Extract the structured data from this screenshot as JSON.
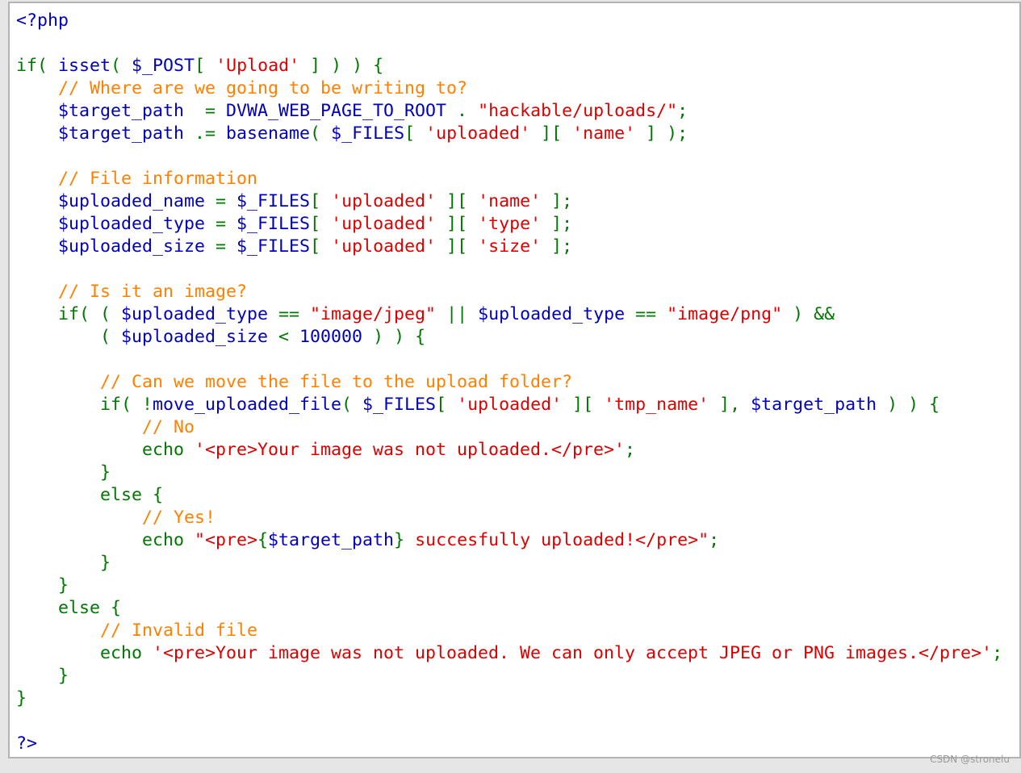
{
  "colors": {
    "html": "#0000bb",
    "default": "#0000bb",
    "keyword": "#007700",
    "string": "#dd0000",
    "comment": "#ff8000",
    "background": "#ffffff",
    "border": "#b4b4b4"
  },
  "code": {
    "language": "php",
    "lines": [
      [
        [
          "html",
          "<?php"
        ]
      ],
      [],
      [
        [
          "keyword",
          "if( "
        ],
        [
          "default",
          "isset"
        ],
        [
          "keyword",
          "( "
        ],
        [
          "default",
          "$_POST"
        ],
        [
          "keyword",
          "[ "
        ],
        [
          "string",
          "'Upload'"
        ],
        [
          "keyword",
          " ] ) ) {"
        ]
      ],
      [
        [
          "comment",
          "    // Where are we going to be writing to?"
        ]
      ],
      [
        [
          "default",
          "    $target_path  "
        ],
        [
          "keyword",
          "= "
        ],
        [
          "default",
          "DVWA_WEB_PAGE_TO_ROOT "
        ],
        [
          "keyword",
          ". "
        ],
        [
          "string",
          "\"hackable/uploads/\""
        ],
        [
          "keyword",
          ";"
        ]
      ],
      [
        [
          "default",
          "    $target_path "
        ],
        [
          "keyword",
          ".= "
        ],
        [
          "default",
          "basename"
        ],
        [
          "keyword",
          "( "
        ],
        [
          "default",
          "$_FILES"
        ],
        [
          "keyword",
          "[ "
        ],
        [
          "string",
          "'uploaded'"
        ],
        [
          "keyword",
          " ][ "
        ],
        [
          "string",
          "'name'"
        ],
        [
          "keyword",
          " ] );"
        ]
      ],
      [],
      [
        [
          "comment",
          "    // File information"
        ]
      ],
      [
        [
          "default",
          "    $uploaded_name "
        ],
        [
          "keyword",
          "= "
        ],
        [
          "default",
          "$_FILES"
        ],
        [
          "keyword",
          "[ "
        ],
        [
          "string",
          "'uploaded'"
        ],
        [
          "keyword",
          " ][ "
        ],
        [
          "string",
          "'name'"
        ],
        [
          "keyword",
          " ];"
        ]
      ],
      [
        [
          "default",
          "    $uploaded_type "
        ],
        [
          "keyword",
          "= "
        ],
        [
          "default",
          "$_FILES"
        ],
        [
          "keyword",
          "[ "
        ],
        [
          "string",
          "'uploaded'"
        ],
        [
          "keyword",
          " ][ "
        ],
        [
          "string",
          "'type'"
        ],
        [
          "keyword",
          " ];"
        ]
      ],
      [
        [
          "default",
          "    $uploaded_size "
        ],
        [
          "keyword",
          "= "
        ],
        [
          "default",
          "$_FILES"
        ],
        [
          "keyword",
          "[ "
        ],
        [
          "string",
          "'uploaded'"
        ],
        [
          "keyword",
          " ][ "
        ],
        [
          "string",
          "'size'"
        ],
        [
          "keyword",
          " ];"
        ]
      ],
      [],
      [
        [
          "comment",
          "    // Is it an image?"
        ]
      ],
      [
        [
          "keyword",
          "    if( ( "
        ],
        [
          "default",
          "$uploaded_type "
        ],
        [
          "keyword",
          "== "
        ],
        [
          "string",
          "\"image/jpeg\""
        ],
        [
          "keyword",
          " || "
        ],
        [
          "default",
          "$uploaded_type "
        ],
        [
          "keyword",
          "== "
        ],
        [
          "string",
          "\"image/png\""
        ],
        [
          "keyword",
          " ) &&"
        ]
      ],
      [
        [
          "keyword",
          "        ( "
        ],
        [
          "default",
          "$uploaded_size "
        ],
        [
          "keyword",
          "< "
        ],
        [
          "default",
          "100000"
        ],
        [
          "keyword",
          " ) ) {"
        ]
      ],
      [],
      [
        [
          "comment",
          "        // Can we move the file to the upload folder?"
        ]
      ],
      [
        [
          "keyword",
          "        if( !"
        ],
        [
          "default",
          "move_uploaded_file"
        ],
        [
          "keyword",
          "( "
        ],
        [
          "default",
          "$_FILES"
        ],
        [
          "keyword",
          "[ "
        ],
        [
          "string",
          "'uploaded'"
        ],
        [
          "keyword",
          " ][ "
        ],
        [
          "string",
          "'tmp_name'"
        ],
        [
          "keyword",
          " ], "
        ],
        [
          "default",
          "$target_path"
        ],
        [
          "keyword",
          " ) ) {"
        ]
      ],
      [
        [
          "comment",
          "            // No"
        ]
      ],
      [
        [
          "keyword",
          "            echo "
        ],
        [
          "string",
          "'<pre>Your image was not uploaded.</pre>'"
        ],
        [
          "keyword",
          ";"
        ]
      ],
      [
        [
          "keyword",
          "        }"
        ]
      ],
      [
        [
          "keyword",
          "        else {"
        ]
      ],
      [
        [
          "comment",
          "            // Yes!"
        ]
      ],
      [
        [
          "keyword",
          "            echo "
        ],
        [
          "string",
          "\"<pre>"
        ],
        [
          "keyword",
          "{"
        ],
        [
          "default",
          "$target_path"
        ],
        [
          "keyword",
          "}"
        ],
        [
          "string",
          " succesfully uploaded!</pre>\""
        ],
        [
          "keyword",
          ";"
        ]
      ],
      [
        [
          "keyword",
          "        }"
        ]
      ],
      [
        [
          "keyword",
          "    }"
        ]
      ],
      [
        [
          "keyword",
          "    else {"
        ]
      ],
      [
        [
          "comment",
          "        // Invalid file"
        ]
      ],
      [
        [
          "keyword",
          "        echo "
        ],
        [
          "string",
          "'<pre>Your image was not uploaded. We can only accept JPEG or PNG images.</pre>'"
        ],
        [
          "keyword",
          ";"
        ]
      ],
      [
        [
          "keyword",
          "    }"
        ]
      ],
      [
        [
          "keyword",
          "}"
        ]
      ],
      [],
      [
        [
          "html",
          "?>"
        ]
      ]
    ]
  },
  "watermark": "CSDN @stronelu"
}
